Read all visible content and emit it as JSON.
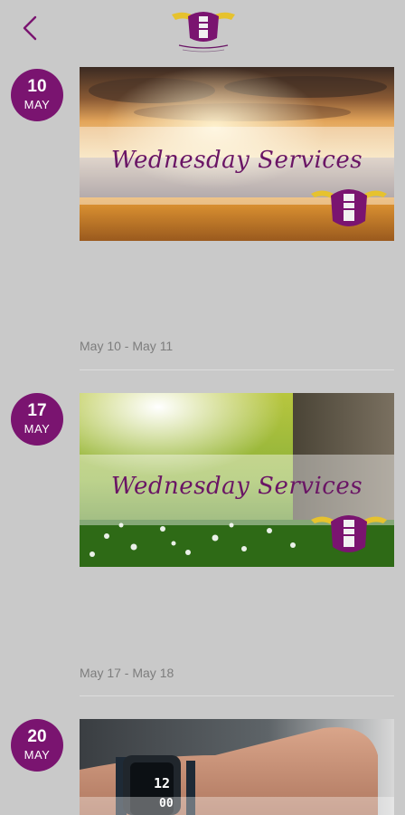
{
  "header": {
    "back_icon": "chevron-left-icon",
    "logo_icon": "church-logo-icon"
  },
  "events": [
    {
      "day": "10",
      "month": "MAY",
      "banner_title": "Wednesday Services",
      "date_range": "May 10 - May 11"
    },
    {
      "day": "17",
      "month": "MAY",
      "banner_title": "Wednesday Services",
      "date_range": "May 17 - May 18"
    },
    {
      "day": "20",
      "month": "MAY",
      "watch_time": "12",
      "watch_time_2": "00"
    }
  ],
  "colors": {
    "accent": "#7a1470",
    "background": "#c9c9c9",
    "title_text": "#6a1565",
    "range_text": "#7d7d7d"
  }
}
